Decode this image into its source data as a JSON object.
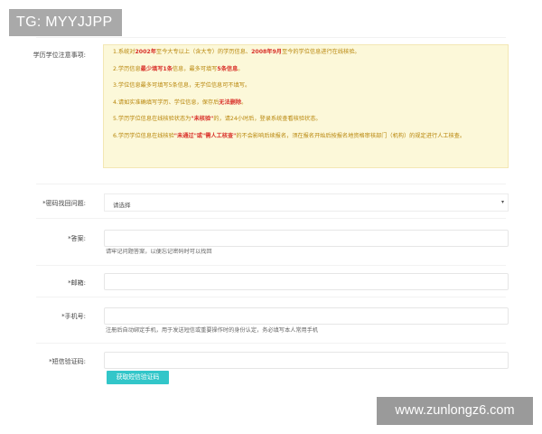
{
  "overlay": {
    "tg_label": "TG: MYYJJPP",
    "watermark": "www.zunlongz6.com"
  },
  "form": {
    "notice_label": "学历学位注意事项:",
    "notice": {
      "line1": {
        "p1": "1.系统对",
        "h1": "2002年",
        "p2": "至今大专以上（含大专）的学历信息、",
        "h2": "2008年9月",
        "p3": "至今的学位信息进行在线核验。"
      },
      "line2": {
        "p1": "2.学历信息",
        "h1": "最少填写1条",
        "p2": "信息，最多可填写",
        "h2": "5条信息",
        "p3": "。"
      },
      "line3": {
        "p1": "3.学位信息最多可填写5条信息，无学位信息可不填写。"
      },
      "line4": {
        "p1": "4.请如实准确填写学历、学位信息，保存后",
        "h1": "无法删除",
        "p2": "。"
      },
      "line5": {
        "p1": "5.学历学位信息在线核验状态为",
        "h1": "\"未核验\"",
        "p2": "的，请24小时后，登录系统查看核验状态。"
      },
      "line6": {
        "p1": "6.学历学位信息在线核验",
        "h1": "\"未通过\"或\"需人工核查\"",
        "p2": "的不会影响后续报名，须在报名开始后按报名地资格审核部门（机构）的规定进行人工核查。"
      }
    },
    "security_question": {
      "label": "*密码找回问题:",
      "selected": "请选择"
    },
    "answer": {
      "label": "*答案:",
      "value": "",
      "hint": "请牢记问题答案，以便忘记密码时可以找回"
    },
    "email": {
      "label": "*邮箱:",
      "value": ""
    },
    "phone": {
      "label": "*手机号:",
      "value": "",
      "hint": "注册后自动绑定手机，用于发送短信或重要操作时的身份认定，务必填写本人常用手机"
    },
    "sms_code": {
      "label": "*短信验证码:",
      "value": "",
      "button": "获取短信验证码"
    }
  }
}
